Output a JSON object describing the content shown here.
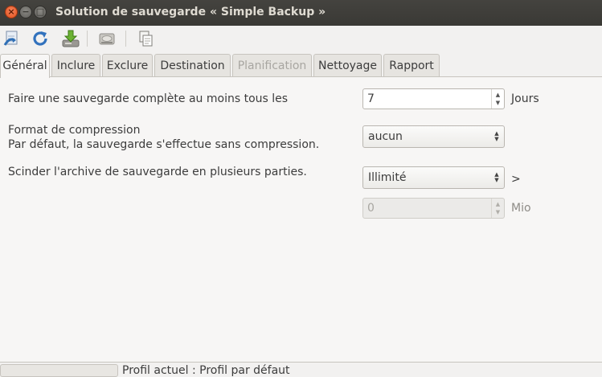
{
  "window": {
    "title": "Solution de sauvegarde « Simple Backup »",
    "close_glyph": "×",
    "minimize_glyph": "−",
    "maximize_glyph": "□"
  },
  "toolbar": {
    "icons": [
      "open-icon",
      "reload-icon",
      "save-icon",
      "drive-icon",
      "copy-icon"
    ]
  },
  "tabs": [
    {
      "label": "Général",
      "state": "active"
    },
    {
      "label": "Inclure",
      "state": "normal"
    },
    {
      "label": "Exclure",
      "state": "normal"
    },
    {
      "label": "Destination",
      "state": "normal"
    },
    {
      "label": "Planification",
      "state": "disabled"
    },
    {
      "label": "Nettoyage",
      "state": "normal"
    },
    {
      "label": "Rapport",
      "state": "normal"
    }
  ],
  "general": {
    "full_backup_label": "Faire une sauvegarde complète au moins tous les",
    "full_backup_value": "7",
    "full_backup_unit": "Jours",
    "compression_label": "Format de compression",
    "compression_hint": "Par défaut, la sauvegarde s'effectue sans compression.",
    "compression_value": "aucun",
    "split_label": "Scinder l'archive de sauvegarde en plusieurs parties.",
    "split_value": "Illimité",
    "split_indicator": ">",
    "split_size_value": "0",
    "split_size_unit": "Mio"
  },
  "status": {
    "text": "Profil actuel : Profil par défaut"
  },
  "colors": {
    "titlebar": "#3c3b37",
    "close_button": "#e9541f",
    "background": "#f2f1f0"
  }
}
